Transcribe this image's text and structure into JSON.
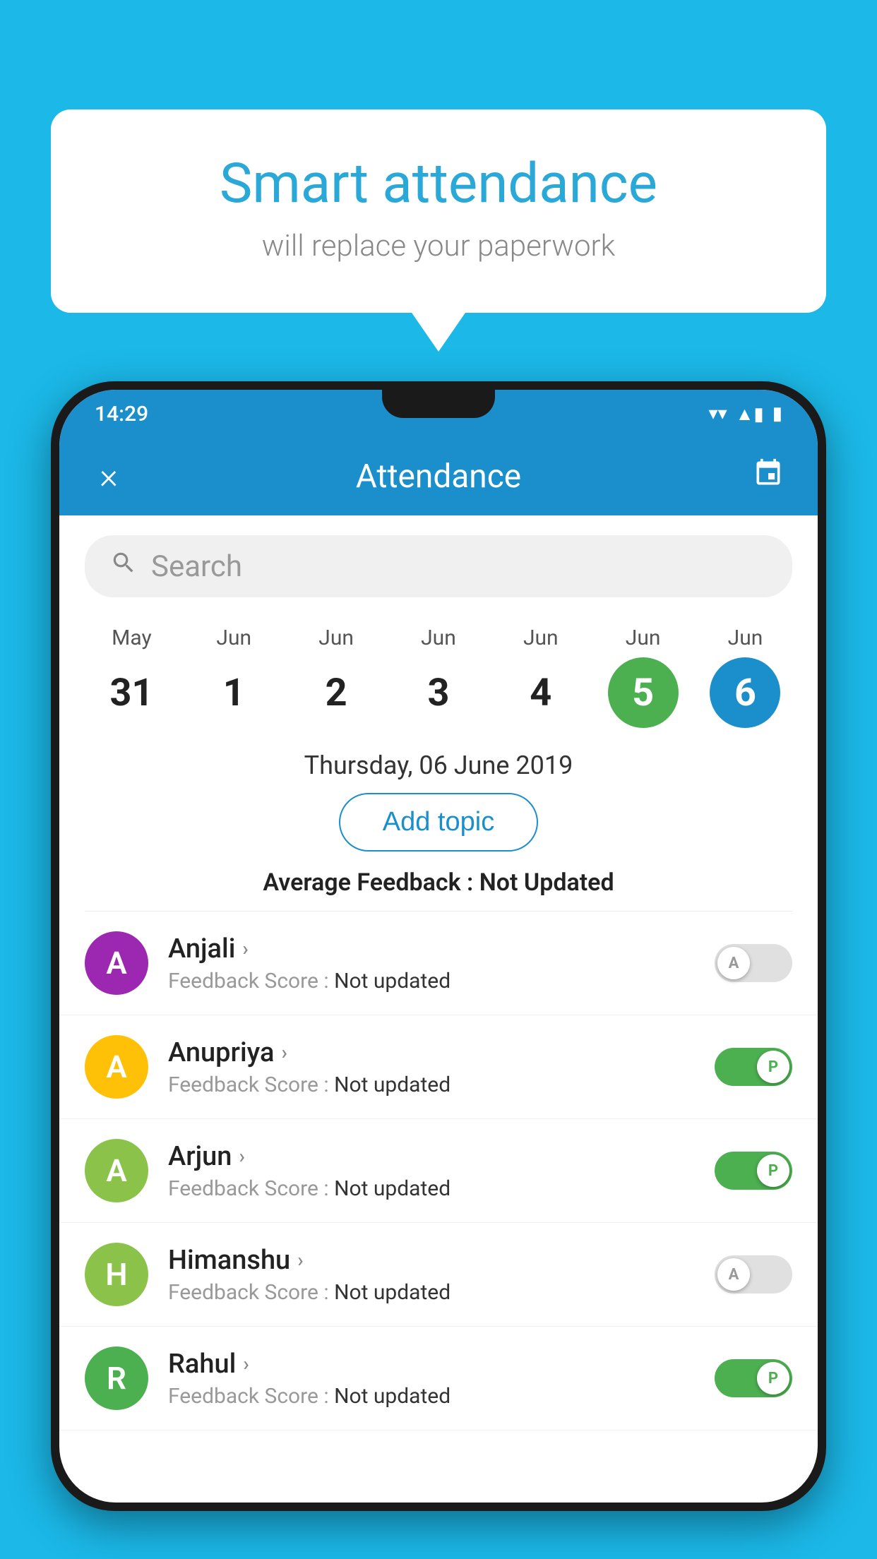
{
  "background_color": "#1BB8E8",
  "speech_bubble": {
    "title": "Smart attendance",
    "subtitle": "will replace your paperwork"
  },
  "status_bar": {
    "time": "14:29",
    "wifi": "▼",
    "signal": "▲",
    "battery": "▮"
  },
  "app_bar": {
    "title": "Attendance",
    "close_label": "×",
    "calendar_icon": "📅"
  },
  "search": {
    "placeholder": "Search"
  },
  "calendar": {
    "days": [
      {
        "month": "May",
        "date": "31",
        "style": "normal"
      },
      {
        "month": "Jun",
        "date": "1",
        "style": "normal"
      },
      {
        "month": "Jun",
        "date": "2",
        "style": "normal"
      },
      {
        "month": "Jun",
        "date": "3",
        "style": "normal"
      },
      {
        "month": "Jun",
        "date": "4",
        "style": "normal"
      },
      {
        "month": "Jun",
        "date": "5",
        "style": "today"
      },
      {
        "month": "Jun",
        "date": "6",
        "style": "selected"
      }
    ]
  },
  "date_heading": "Thursday, 06 June 2019",
  "add_topic_label": "Add topic",
  "avg_feedback_label": "Average Feedback : ",
  "avg_feedback_value": "Not Updated",
  "students": [
    {
      "name": "Anjali",
      "initial": "A",
      "avatar_color": "#9C27B0",
      "feedback_label": "Feedback Score : ",
      "feedback_value": "Not updated",
      "toggle": "off",
      "toggle_letter": "A"
    },
    {
      "name": "Anupriya",
      "initial": "A",
      "avatar_color": "#FFC107",
      "feedback_label": "Feedback Score : ",
      "feedback_value": "Not updated",
      "toggle": "on",
      "toggle_letter": "P"
    },
    {
      "name": "Arjun",
      "initial": "A",
      "avatar_color": "#8BC34A",
      "feedback_label": "Feedback Score : ",
      "feedback_value": "Not updated",
      "toggle": "on",
      "toggle_letter": "P"
    },
    {
      "name": "Himanshu",
      "initial": "H",
      "avatar_color": "#8BC34A",
      "feedback_label": "Feedback Score : ",
      "feedback_value": "Not updated",
      "toggle": "off",
      "toggle_letter": "A"
    },
    {
      "name": "Rahul",
      "initial": "R",
      "avatar_color": "#4CAF50",
      "feedback_label": "Feedback Score : ",
      "feedback_value": "Not updated",
      "toggle": "on",
      "toggle_letter": "P"
    }
  ]
}
